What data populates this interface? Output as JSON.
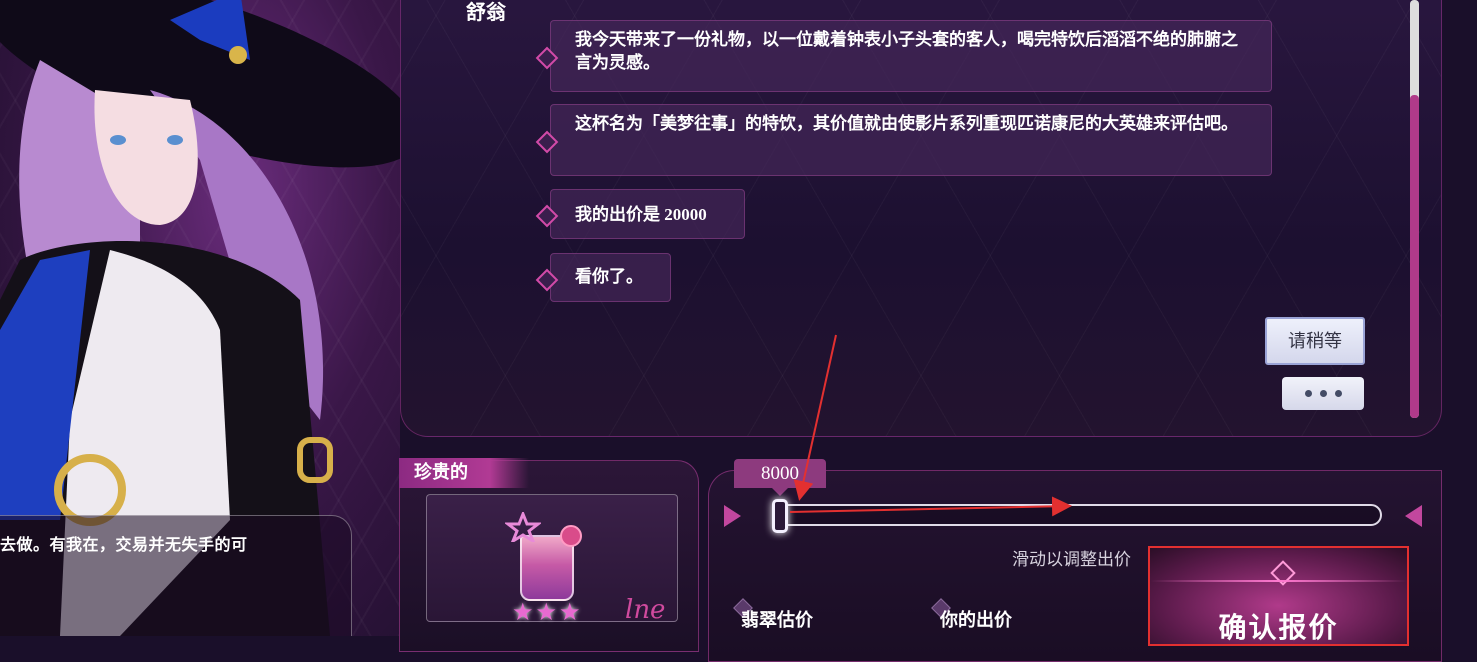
{
  "chat": {
    "speaker": "舒翁",
    "messages": [
      "我今天带来了一份礼物，以一位戴着钟表小子头套的客人，喝完特饮后滔滔不绝的肺腑之言为灵感。",
      "这杯名为「美梦往事」的特饮，其价值就由使影片系列重现匹诺康尼的大英雄来评估吧。",
      "我的出价是 20000",
      "看你了。"
    ],
    "wait_button": "请稍等",
    "more_button_icon": "ellipsis-icon"
  },
  "dialogue": {
    "text": "去做。有我在，交易并无失手的可"
  },
  "item": {
    "rarity": "珍贵的",
    "stars": "★★★",
    "signature": "lne"
  },
  "bid": {
    "current_price": "8000",
    "slider_level": 0.0,
    "hint": "滑动以调整出价",
    "estimate_label": "翡翠估价",
    "your_bid_label": "你的出价",
    "confirm_label": "确认报价"
  },
  "colors": {
    "accent": "#c2479e",
    "annotation": "#e33030"
  }
}
